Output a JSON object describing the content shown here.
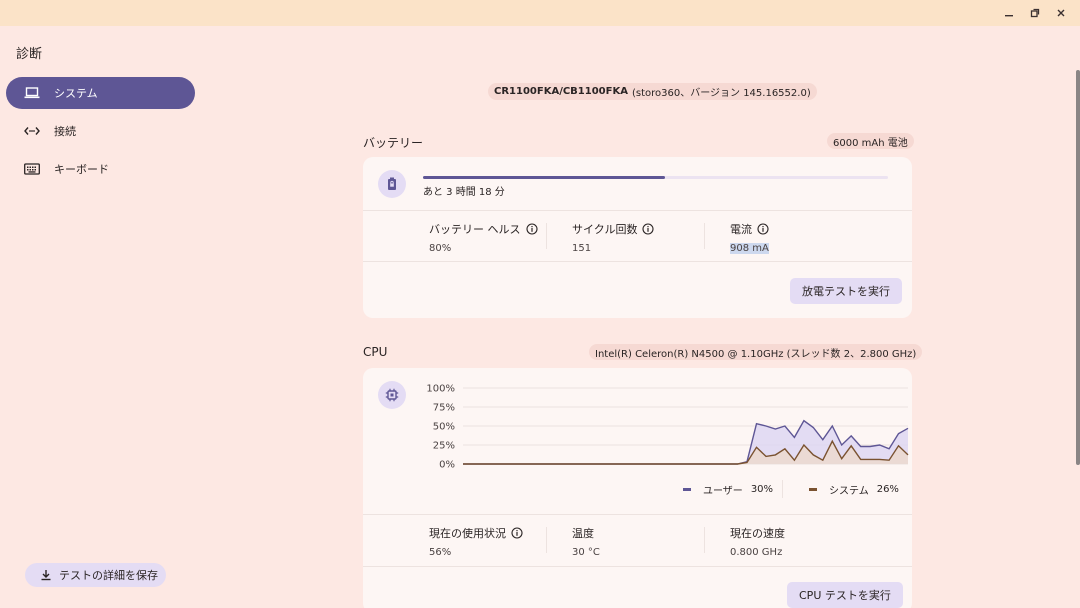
{
  "window": {
    "minimize_icon": "minimize-icon",
    "restore_icon": "restore-icon",
    "close_icon": "close-icon"
  },
  "app": {
    "title": "診断"
  },
  "sidebar": {
    "items": [
      {
        "label": "システム",
        "icon": "laptop-icon",
        "active": true
      },
      {
        "label": "接続",
        "icon": "connection-arrows-icon",
        "active": false
      },
      {
        "label": "キーボード",
        "icon": "keyboard-icon",
        "active": false
      }
    ],
    "save_button": {
      "label": "テストの詳細を保存",
      "icon": "download-icon"
    }
  },
  "device": {
    "model": "CR1100FKA/CB1100FKA",
    "detail": "(storo360、バージョン 145.16552.0)"
  },
  "battery": {
    "title": "バッテリー",
    "capacity": "6000 mAh 電池",
    "remaining": "あと 3 時間 18 分",
    "charge_fraction": 0.52,
    "health_label": "バッテリー ヘルス",
    "health_value": "80%",
    "cycle_label": "サイクル回数",
    "cycle_value": "151",
    "current_label": "電流",
    "current_value": "908 mA",
    "action": "放電テストを実行",
    "icon": "battery-lock-icon"
  },
  "cpu": {
    "title": "CPU",
    "spec": "Intel(R) Celeron(R) N4500 @ 1.10GHz (スレッド数 2、2.800 GHz)",
    "icon": "cpu-chip-icon",
    "usage_label": "現在の使用状況",
    "usage_value": "56%",
    "temp_label": "温度",
    "temp_value": "30 °C",
    "speed_label": "現在の速度",
    "speed_value": "0.800 GHz",
    "action": "CPU テストを実行",
    "legend_user": "ユーザー",
    "legend_user_value": "30%",
    "legend_system": "システム",
    "legend_system_value": "26%",
    "colors": {
      "user": "#5e5695",
      "system": "#7a5230",
      "user_fill": "#dcd6f2",
      "system_fill": "#ecd9cc"
    }
  },
  "chart_data": {
    "type": "area",
    "yticks": [
      "100%",
      "75%",
      "50%",
      "25%",
      "0%"
    ],
    "ylim": [
      0,
      100
    ],
    "x": [
      0,
      1,
      2,
      3,
      4,
      5,
      6,
      7,
      8,
      9,
      10,
      11,
      12,
      13,
      14,
      15,
      16,
      17,
      18,
      19,
      20,
      21,
      22,
      23,
      24,
      25,
      26,
      27,
      28,
      29,
      30,
      31,
      32,
      33,
      34,
      35,
      36,
      37,
      38,
      39,
      40,
      41,
      42,
      43,
      44,
      45,
      46,
      47
    ],
    "series": [
      {
        "name": "ユーザー",
        "values": [
          0,
          0,
          0,
          0,
          0,
          0,
          0,
          0,
          0,
          0,
          0,
          0,
          0,
          0,
          0,
          0,
          0,
          0,
          0,
          0,
          0,
          0,
          0,
          0,
          0,
          0,
          0,
          0,
          0,
          0,
          3,
          53,
          50,
          46,
          50,
          35,
          57,
          48,
          32,
          50,
          25,
          37,
          23,
          23,
          25,
          20,
          40,
          47
        ]
      },
      {
        "name": "システム",
        "values": [
          0,
          0,
          0,
          0,
          0,
          0,
          0,
          0,
          0,
          0,
          0,
          0,
          0,
          0,
          0,
          0,
          0,
          0,
          0,
          0,
          0,
          0,
          0,
          0,
          0,
          0,
          0,
          0,
          0,
          0,
          2,
          22,
          10,
          12,
          20,
          5,
          25,
          12,
          5,
          30,
          7,
          24,
          6,
          6,
          6,
          5,
          24,
          12
        ]
      }
    ]
  }
}
